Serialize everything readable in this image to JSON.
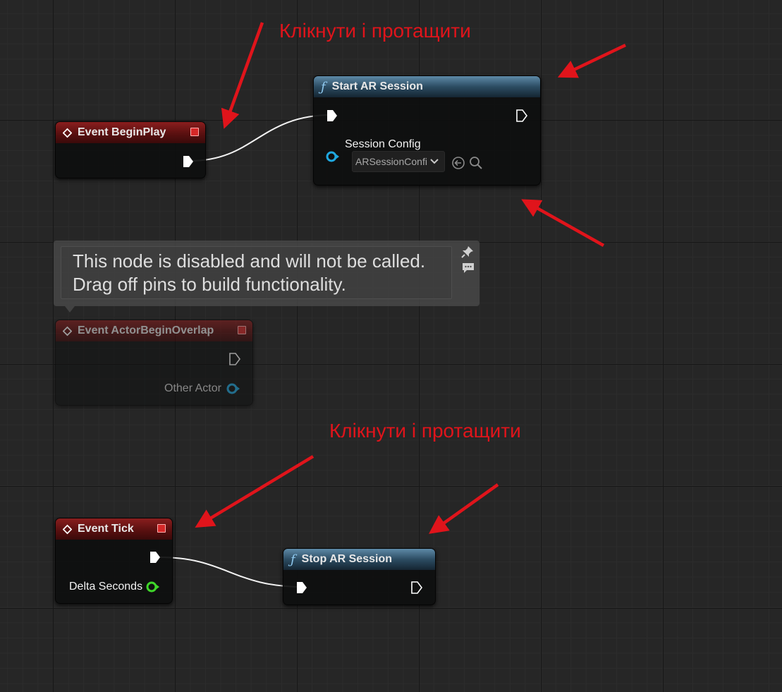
{
  "annotations": [
    {
      "text": "Клікнути і протащити"
    },
    {
      "text": "Клікнути і протащити"
    }
  ],
  "nodes": {
    "begin_play": {
      "title": "Event BeginPlay"
    },
    "start_ar": {
      "title": "Start AR Session",
      "param_label": "Session Config",
      "param_value": "ARSessionConfi"
    },
    "overlap": {
      "title": "Event ActorBeginOverlap",
      "pin_label": "Other Actor",
      "tooltip_lines": [
        "This node is disabled and will not be called.",
        "Drag off pins to build functionality."
      ]
    },
    "tick": {
      "title": "Event Tick",
      "pin_label": "Delta Seconds"
    },
    "stop_ar": {
      "title": "Stop AR Session"
    }
  },
  "icons": {
    "event_node": "diamond-icon",
    "function_node": "function-icon",
    "exec_pin": "exec-pin-icon",
    "object_pin": "object-pin-icon",
    "float_pin": "float-pin-icon",
    "use_selected": "use-selected-icon",
    "browse": "search-icon",
    "pin_comment": "pushpin-icon",
    "comment": "comment-icon"
  },
  "colors": {
    "event_header": "#8a1e1e",
    "function_header": "#2c4c62",
    "object_pin": "#1fa8e0",
    "float_pin": "#3fd62a",
    "annotation": "#e0141b",
    "wire": "#f2f2f2"
  }
}
